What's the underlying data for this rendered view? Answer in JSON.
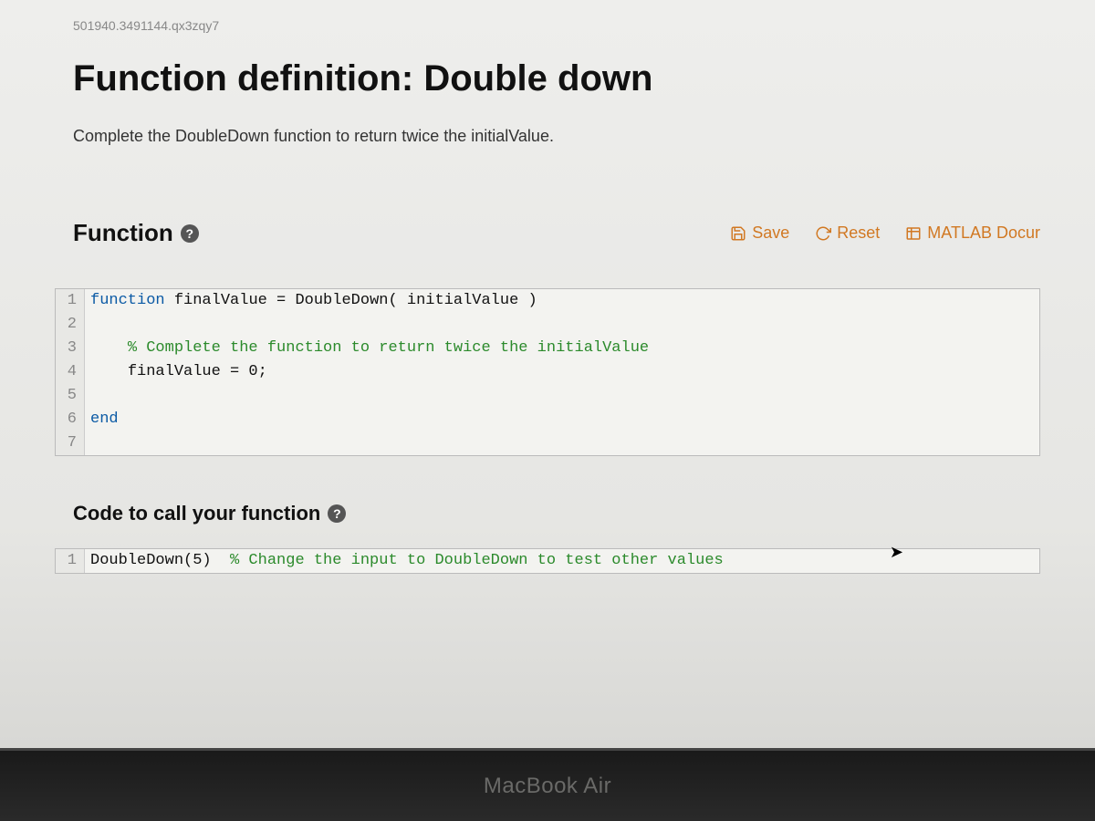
{
  "questionId": "501940.3491144.qx3zqy7",
  "title": "Function definition: Double down",
  "instructions": "Complete the DoubleDown function to return twice the initialValue.",
  "functionHeader": {
    "label": "Function",
    "help": "?"
  },
  "toolbar": {
    "save": "Save",
    "reset": "Reset",
    "docs": "MATLAB Docur"
  },
  "editor": {
    "lines": [
      {
        "num": "1",
        "segments": [
          {
            "cls": "kw",
            "t": "function"
          },
          {
            "cls": "",
            "t": " "
          },
          {
            "cls": "vr",
            "t": "finalValue = DoubleDown( initialValue )"
          }
        ]
      },
      {
        "num": "2",
        "segments": []
      },
      {
        "num": "3",
        "segments": [
          {
            "cls": "",
            "t": "    "
          },
          {
            "cls": "cm",
            "t": "% Complete the function to return twice the initialValue"
          }
        ]
      },
      {
        "num": "4",
        "segments": [
          {
            "cls": "",
            "t": "    "
          },
          {
            "cls": "vr",
            "t": "finalValue = 0;"
          }
        ]
      },
      {
        "num": "5",
        "segments": []
      },
      {
        "num": "6",
        "segments": [
          {
            "cls": "kw",
            "t": "end"
          }
        ]
      },
      {
        "num": "7",
        "segments": []
      }
    ]
  },
  "callSection": {
    "label": "Code to call your function",
    "help": "?"
  },
  "callEditor": {
    "lines": [
      {
        "num": "1",
        "segments": [
          {
            "cls": "vr",
            "t": "DoubleDown(5)  "
          },
          {
            "cls": "cm",
            "t": "% Change the input to DoubleDown to test other values"
          }
        ]
      }
    ]
  },
  "laptop": "MacBook Air"
}
